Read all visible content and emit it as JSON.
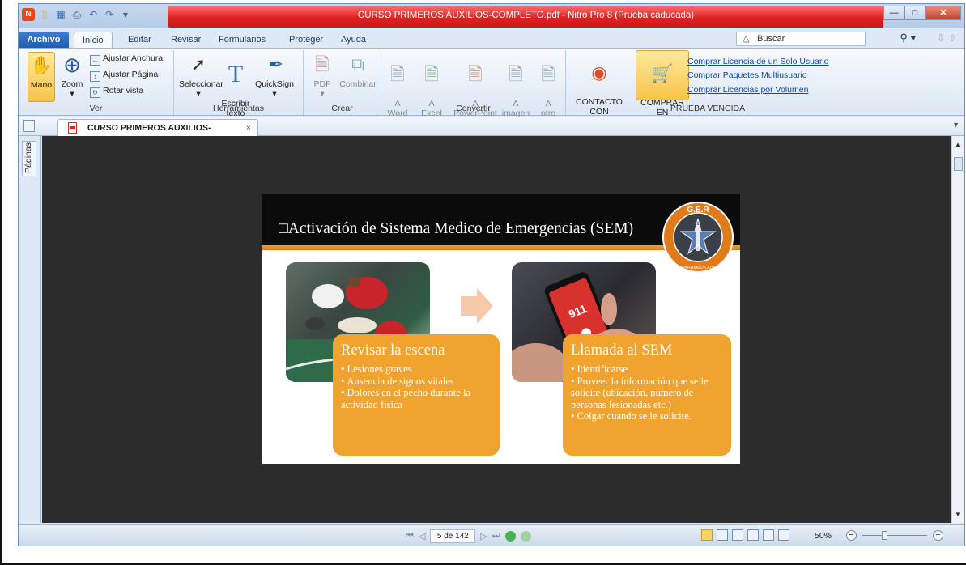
{
  "window": {
    "title": "CURSO PRIMEROS AUXILIOS-COMPLETO.pdf - Nitro Pro 8 (Prueba caducada)",
    "controls": [
      "minimize-icon",
      "maximize-icon",
      "close-icon"
    ]
  },
  "quick_access": [
    "nitro-logo-icon",
    "open-icon",
    "save-icon",
    "print-icon",
    "undo-icon",
    "redo-icon",
    "customize-icon"
  ],
  "ribbon_tabs": [
    "Archivo",
    "Inicio",
    "Editar",
    "Revisar",
    "Formularios",
    "Proteger",
    "Ayuda"
  ],
  "active_tab": "Inicio",
  "search": {
    "placeholder": "Buscar"
  },
  "groups": {
    "ver": {
      "label": "Ver",
      "mano": "Mano",
      "zoom": "Zoom",
      "ajustar_anchura": "Ajustar Anchura",
      "ajustar_pagina": "Ajustar Página",
      "rotar_vista": "Rotar vista"
    },
    "herramientas": {
      "label": "Herramientas",
      "seleccionar": "Seleccionar",
      "escribir_texto": "Escribir\ntexto",
      "quicksign": "QuickSign"
    },
    "crear": {
      "label": "Crear",
      "pdf": "PDF",
      "combinar": "Combinar"
    },
    "convertir": {
      "label": "Convertir",
      "word": "A\nWord",
      "excel": "A\nExcel",
      "powerpoint": "A\nPowerPoint",
      "imagen": "A\nimagen",
      "otro": "A\notro"
    },
    "prueba": {
      "label": "PRUEBA VENCIDA",
      "contacto": "CONTACTO CON\nASISTENCIA",
      "comprar": "COMPRAR EN\nLÍNEA AHORA",
      "links": [
        "Comprar Licencia de un Solo Usuario",
        "Comprar Paquetes Multiusuario",
        "Comprar Licencias por Volumen"
      ]
    }
  },
  "document_tab": {
    "title": "CURSO PRIMEROS AUXILIOS-COMPLETO",
    "close": "×"
  },
  "side_panel": {
    "label": "Páginas"
  },
  "slide": {
    "title": "□Activación de Sistema Medico de Emergencias (SEM)",
    "logo_text": "G.E.R RESCATE PARAMÉDICOS",
    "left_box": {
      "heading": "Revisar la escena",
      "bullets": [
        "Lesiones graves",
        "Ausencia de signos vitales",
        "Dolores en el pecho durante la actividad física"
      ]
    },
    "right_box": {
      "heading": "Llamada al SEM",
      "bullets": [
        "Identificarse",
        "Proveer la información que se le solicite (ubicación, numero de personas lesionadas etc.)",
        "Colgar cuando se le solicite."
      ]
    },
    "phone_text": "911",
    "colors": {
      "header": "#0b0b0b",
      "accent": "#f0a32e"
    }
  },
  "status_bar": {
    "page_indicator": "5 de 142",
    "zoom": "50%"
  }
}
